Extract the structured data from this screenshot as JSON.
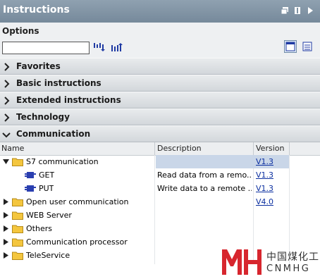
{
  "panel": {
    "title": "Instructions"
  },
  "options": {
    "label": "Options",
    "search_value": "",
    "search_placeholder": ""
  },
  "sections": [
    {
      "label": "Favorites",
      "expanded": false
    },
    {
      "label": "Basic instructions",
      "expanded": false
    },
    {
      "label": "Extended instructions",
      "expanded": false
    },
    {
      "label": "Technology",
      "expanded": false
    },
    {
      "label": "Communication",
      "expanded": true
    }
  ],
  "grid": {
    "columns": {
      "name": "Name",
      "description": "Description",
      "version": "Version"
    },
    "rows": [
      {
        "name": "S7 communication",
        "description": "",
        "version": "V1.3",
        "type": "folder",
        "expanded": true,
        "selected": true
      },
      {
        "name": "GET",
        "description": "Read data from a remo...",
        "version": "V1.3",
        "type": "block"
      },
      {
        "name": "PUT",
        "description": "Write data to a remote ...",
        "version": "V1.3",
        "type": "block"
      },
      {
        "name": "Open user communication",
        "description": "",
        "version": "V4.0",
        "type": "folder",
        "expanded": false
      },
      {
        "name": "WEB Server",
        "description": "",
        "version": "",
        "type": "folder",
        "expanded": false
      },
      {
        "name": "Others",
        "description": "",
        "version": "",
        "type": "folder",
        "expanded": false
      },
      {
        "name": "Communication processor",
        "description": "",
        "version": "",
        "type": "folder",
        "expanded": false
      },
      {
        "name": "TeleService",
        "description": "",
        "version": "",
        "type": "folder",
        "expanded": false
      }
    ]
  },
  "watermark": {
    "cn": "中国煤化工",
    "en": "CNMHG"
  },
  "icons": {
    "restore": "restore-icon",
    "pin": "pin-icon",
    "arrow": "arrow-right-icon",
    "expand": "expand-all-icon",
    "collapse": "collapse-all-icon",
    "view_detail": "view-detail-icon",
    "view_list": "view-list-icon",
    "folder": "folder-icon",
    "block": "function-block-icon"
  },
  "colors": {
    "titlebar": "#7f92a3",
    "section": "#dfe2e5",
    "selected_row": "#c9d6e8",
    "link": "#0b2fa0",
    "folder": "#f4c63e",
    "block": "#2a3fb0",
    "logo": "#d7262e"
  }
}
